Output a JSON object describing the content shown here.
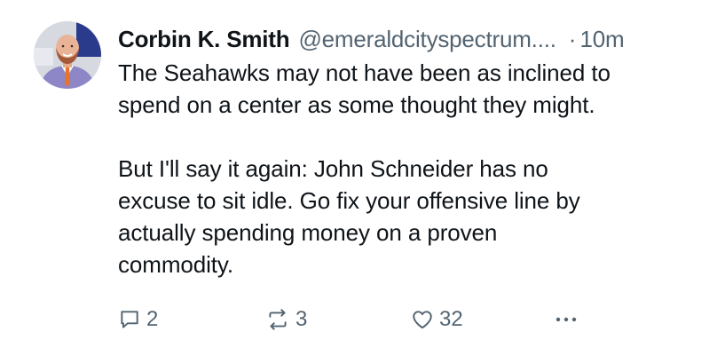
{
  "tweet": {
    "author_name": "Corbin K. Smith",
    "author_handle": "@emeraldcityspectrum....",
    "separator": "·",
    "timestamp": "10m",
    "text": {
      "paragraph_1_line_1": "The Seahawks may not have been as inclined to",
      "paragraph_1_line_2": "spend on a center as some thought they might.",
      "paragraph_2_line_1": "But I'll say it again: John Schneider has no",
      "paragraph_2_line_2": "excuse to sit idle. Go fix your offensive line by",
      "paragraph_2_line_3": "actually spending money on a proven",
      "paragraph_2_line_4": "commodity."
    },
    "actions": {
      "reply_count": "2",
      "retweet_count": "3",
      "like_count": "32"
    }
  },
  "colors": {
    "text_primary": "#0f1419",
    "text_secondary": "#536471",
    "icon_color": "#536471",
    "background": "#ffffff"
  },
  "icons": {
    "reply": "reply-icon",
    "retweet": "retweet-icon",
    "like": "heart-icon",
    "more": "more-icon"
  }
}
